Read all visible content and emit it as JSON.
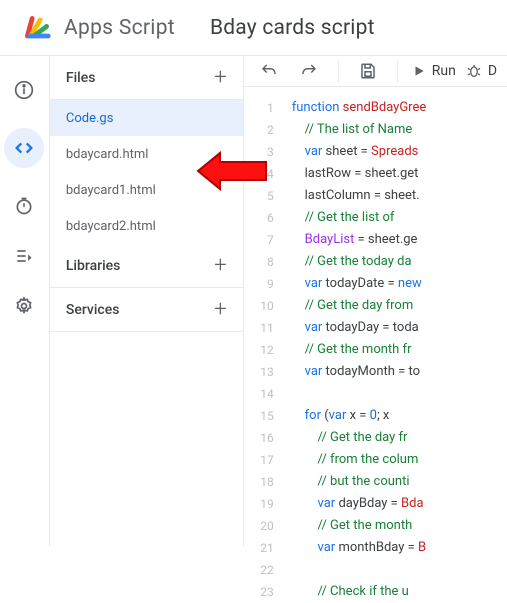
{
  "header": {
    "app_title": "Apps Script",
    "project_title": "Bday cards script"
  },
  "sidebar": {
    "files_label": "Files",
    "libraries_label": "Libraries",
    "services_label": "Services",
    "files": [
      {
        "name": "Code.gs",
        "selected": true
      },
      {
        "name": "bdaycard.html",
        "selected": false
      },
      {
        "name": "bdaycard1.html",
        "selected": false
      },
      {
        "name": "bdaycard2.html",
        "selected": false
      }
    ]
  },
  "toolbar": {
    "run_label": "Run",
    "debug_label": "D"
  },
  "editor": {
    "line_count": 23,
    "lines": [
      [
        {
          "t": "kw",
          "v": "function"
        },
        {
          "t": "",
          "v": " "
        },
        {
          "t": "fn",
          "v": "sendBdayGree"
        }
      ],
      [
        {
          "t": "",
          "v": "    "
        },
        {
          "t": "cm",
          "v": "// The list of Name"
        }
      ],
      [
        {
          "t": "",
          "v": "    "
        },
        {
          "t": "kw",
          "v": "var"
        },
        {
          "t": "",
          "v": " sheet = "
        },
        {
          "t": "cls",
          "v": "Spreads"
        }
      ],
      [
        {
          "t": "",
          "v": "    lastRow = sheet.get"
        }
      ],
      [
        {
          "t": "",
          "v": "    lastColumn = sheet."
        }
      ],
      [
        {
          "t": "",
          "v": "    "
        },
        {
          "t": "cm",
          "v": "// Get the list of"
        }
      ],
      [
        {
          "t": "",
          "v": "    "
        },
        {
          "t": "decl",
          "v": "BdayList"
        },
        {
          "t": "",
          "v": " = sheet.ge"
        }
      ],
      [
        {
          "t": "",
          "v": "    "
        },
        {
          "t": "cm",
          "v": "// Get the today da"
        }
      ],
      [
        {
          "t": "",
          "v": "    "
        },
        {
          "t": "kw",
          "v": "var"
        },
        {
          "t": "",
          "v": " todayDate = "
        },
        {
          "t": "kw",
          "v": "new"
        }
      ],
      [
        {
          "t": "",
          "v": "    "
        },
        {
          "t": "cm",
          "v": "// Get the day from"
        }
      ],
      [
        {
          "t": "",
          "v": "    "
        },
        {
          "t": "kw",
          "v": "var"
        },
        {
          "t": "",
          "v": " todayDay = toda"
        }
      ],
      [
        {
          "t": "",
          "v": "    "
        },
        {
          "t": "cm",
          "v": "// Get the month fr"
        }
      ],
      [
        {
          "t": "",
          "v": "    "
        },
        {
          "t": "kw",
          "v": "var"
        },
        {
          "t": "",
          "v": " todayMonth = to"
        }
      ],
      [
        {
          "t": "",
          "v": " "
        }
      ],
      [
        {
          "t": "",
          "v": "    "
        },
        {
          "t": "kw",
          "v": "for"
        },
        {
          "t": "",
          "v": " ("
        },
        {
          "t": "kw",
          "v": "var"
        },
        {
          "t": "",
          "v": " x = "
        },
        {
          "t": "num",
          "v": "0"
        },
        {
          "t": "",
          "v": "; x "
        }
      ],
      [
        {
          "t": "",
          "v": "        "
        },
        {
          "t": "cm",
          "v": "// Get the day fr"
        }
      ],
      [
        {
          "t": "",
          "v": "        "
        },
        {
          "t": "cm",
          "v": "// from the colum"
        }
      ],
      [
        {
          "t": "",
          "v": "        "
        },
        {
          "t": "cm",
          "v": "// but the counti"
        }
      ],
      [
        {
          "t": "",
          "v": "        "
        },
        {
          "t": "kw",
          "v": "var"
        },
        {
          "t": "",
          "v": " dayBday = "
        },
        {
          "t": "cls",
          "v": "Bda"
        }
      ],
      [
        {
          "t": "",
          "v": "        "
        },
        {
          "t": "cm",
          "v": "// Get the month"
        }
      ],
      [
        {
          "t": "",
          "v": "        "
        },
        {
          "t": "kw",
          "v": "var"
        },
        {
          "t": "",
          "v": " monthBday = "
        },
        {
          "t": "cls",
          "v": "B"
        }
      ],
      [
        {
          "t": "",
          "v": " "
        }
      ],
      [
        {
          "t": "",
          "v": "        "
        },
        {
          "t": "cm",
          "v": "// Check if the u"
        }
      ]
    ]
  }
}
